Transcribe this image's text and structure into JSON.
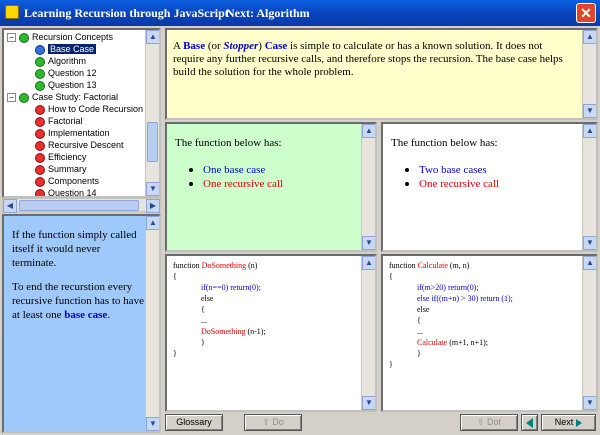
{
  "window": {
    "title": "Learning Recursion through JavaScript",
    "next": "Next: Algorithm",
    "close": "✕"
  },
  "tree": [
    {
      "label": "Recursion Concepts",
      "toggle": "−",
      "face": "green",
      "level": 1
    },
    {
      "label": "Base Case",
      "face": "blue",
      "level": 2,
      "selected": true
    },
    {
      "label": "Algorithm",
      "face": "green",
      "level": 2
    },
    {
      "label": "Question 12",
      "face": "green",
      "level": 2
    },
    {
      "label": "Question 13",
      "face": "green",
      "level": 2
    },
    {
      "label": "Case Study: Factorial",
      "toggle": "−",
      "face": "green",
      "level": 1
    },
    {
      "label": "How to Code Recursion",
      "face": "red",
      "level": 2
    },
    {
      "label": "Factorial",
      "face": "red",
      "level": 2
    },
    {
      "label": "Implementation",
      "face": "red",
      "level": 2
    },
    {
      "label": "Recursive Descent",
      "face": "red",
      "level": 2
    },
    {
      "label": "Efficiency",
      "face": "red",
      "level": 2
    },
    {
      "label": "Summary",
      "face": "red",
      "level": 2
    },
    {
      "label": "Components",
      "face": "red",
      "level": 2
    },
    {
      "label": "Question 14",
      "face": "red",
      "level": 2
    }
  ],
  "hint": {
    "p1": "If the function simply called itself it would never terminate.",
    "p2_start": "To end the recurstion every recursive function has to have at least one ",
    "p2_bold": "base case",
    "p2_end": "."
  },
  "description": {
    "prefix": "A ",
    "base": "Base",
    "or": " (or ",
    "stopper": "Stopper",
    "close": ") ",
    "case": "Case",
    "rest": " is simple to calculate or has a known solution. It does not require any further recursive calls, and therefore stops the recursion. The base case helps build the solution for the whole problem."
  },
  "left_panel": {
    "heading": "The function below has:",
    "b1": "One base case",
    "b2": "One recursive call"
  },
  "right_panel": {
    "heading": "The function below has:",
    "b1": "Two base cases",
    "b2": "One recursive call"
  },
  "code_left": {
    "l1a": "function ",
    "l1b": "DoSomething",
    "l1c": " (n)",
    "l2": "{",
    "l3": "if(n==0) return(0);",
    "l4": "else",
    "l5": "{",
    "l6": "...",
    "l7a": "DoSomething",
    "l7b": " (n-1);",
    "l8": "}",
    "l9": "}"
  },
  "code_right": {
    "l1a": "function ",
    "l1b": "Calculate",
    "l1c": " (m, n)",
    "l2": "{",
    "l3": "if(m>20) return(0);",
    "l4": "else if((m+n) > 30) return (1);",
    "l5": "else",
    "l6": "{",
    "l7": "...",
    "l8a": "Calculate",
    "l8b": " (m+1, n+1);",
    "l9": "}",
    "l10": "}"
  },
  "buttons": {
    "glossary": "Glossary",
    "do": "Do",
    "dot": "Dot",
    "next": "Next"
  }
}
